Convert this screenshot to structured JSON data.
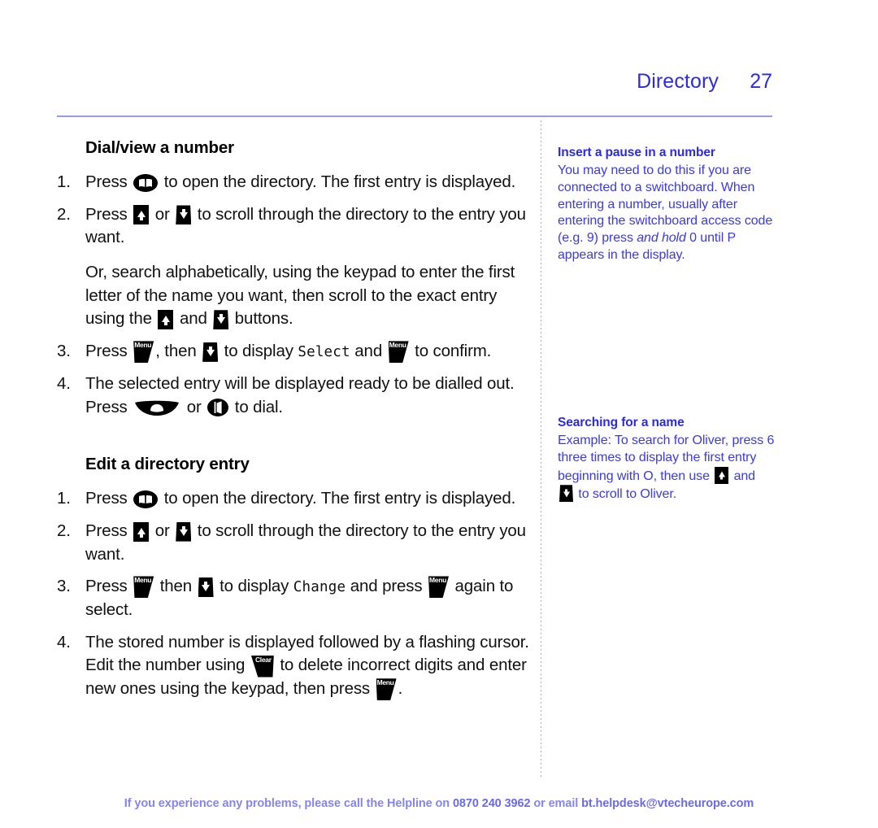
{
  "header": {
    "title": "Directory",
    "page_number": "27"
  },
  "main": {
    "sections": [
      {
        "heading": "Dial/view a number",
        "steps": [
          {
            "number": "1.",
            "parts": [
              {
                "t": "text",
                "v": "Press "
              },
              {
                "t": "icon",
                "v": "directory-book-key"
              },
              {
                "t": "text",
                "v": " to open the directory. The first entry is displayed."
              }
            ]
          },
          {
            "number": "2.",
            "parts": [
              {
                "t": "text",
                "v": "Press "
              },
              {
                "t": "icon",
                "v": "scroll-up-key"
              },
              {
                "t": "text",
                "v": " or "
              },
              {
                "t": "icon",
                "v": "scroll-down-key"
              },
              {
                "t": "text",
                "v": " to scroll through the directory to the entry you want."
              }
            ]
          },
          {
            "number": "",
            "substep": true,
            "parts": [
              {
                "t": "text",
                "v": "Or, search alphabetically, using the keypad to enter the first letter of the name you want, then scroll to the exact entry using the "
              },
              {
                "t": "icon",
                "v": "scroll-up-key"
              },
              {
                "t": "text",
                "v": " and "
              },
              {
                "t": "icon",
                "v": "scroll-down-key"
              },
              {
                "t": "text",
                "v": " buttons."
              }
            ]
          },
          {
            "number": "3.",
            "parts": [
              {
                "t": "text",
                "v": "Press "
              },
              {
                "t": "icon",
                "v": "menu-key"
              },
              {
                "t": "text",
                "v": ", then "
              },
              {
                "t": "icon",
                "v": "scroll-down-key"
              },
              {
                "t": "text",
                "v": " to display "
              },
              {
                "t": "lcd",
                "v": "Select"
              },
              {
                "t": "text",
                "v": " and "
              },
              {
                "t": "icon",
                "v": "menu-key"
              },
              {
                "t": "text",
                "v": " to confirm."
              }
            ]
          },
          {
            "number": "4.",
            "parts": [
              {
                "t": "text",
                "v": "The selected entry will be displayed ready to be dialled out. Press "
              },
              {
                "t": "icon",
                "v": "talk-handset-key"
              },
              {
                "t": "text",
                "v": " or "
              },
              {
                "t": "icon",
                "v": "speakerphone-key"
              },
              {
                "t": "text",
                "v": " to dial."
              }
            ]
          }
        ]
      },
      {
        "heading": "Edit a directory entry",
        "steps": [
          {
            "number": "1.",
            "parts": [
              {
                "t": "text",
                "v": "Press "
              },
              {
                "t": "icon",
                "v": "directory-book-key"
              },
              {
                "t": "text",
                "v": " to open the directory. The first entry is displayed."
              }
            ]
          },
          {
            "number": "2.",
            "parts": [
              {
                "t": "text",
                "v": "Press "
              },
              {
                "t": "icon",
                "v": "scroll-up-key"
              },
              {
                "t": "text",
                "v": " or "
              },
              {
                "t": "icon",
                "v": "scroll-down-key"
              },
              {
                "t": "text",
                "v": " to scroll through the directory to the entry you want."
              }
            ]
          },
          {
            "number": "3.",
            "parts": [
              {
                "t": "text",
                "v": "Press "
              },
              {
                "t": "icon",
                "v": "menu-key"
              },
              {
                "t": "text",
                "v": " then "
              },
              {
                "t": "icon",
                "v": "scroll-down-key"
              },
              {
                "t": "text",
                "v": " to display "
              },
              {
                "t": "lcd",
                "v": "Change"
              },
              {
                "t": "text",
                "v": " and press "
              },
              {
                "t": "icon",
                "v": "menu-key"
              },
              {
                "t": "text",
                "v": " again to select."
              }
            ]
          },
          {
            "number": "4.",
            "parts": [
              {
                "t": "text",
                "v": "The stored number is displayed followed by a flashing cursor. Edit the number using "
              },
              {
                "t": "icon",
                "v": "clear-key"
              },
              {
                "t": "text",
                "v": " to delete incorrect digits and enter new ones using the keypad, then press "
              },
              {
                "t": "icon",
                "v": "menu-key"
              },
              {
                "t": "text",
                "v": "."
              }
            ]
          }
        ]
      }
    ]
  },
  "sidebar": {
    "blocks": [
      {
        "heading": "Insert a pause in a number",
        "parts": [
          {
            "t": "text",
            "v": "You may need to do this if you are connected to a switchboard. When entering a number, usually after entering the switchboard access code (e.g. 9) press "
          },
          {
            "t": "italic",
            "v": "and hold"
          },
          {
            "t": "text",
            "v": " 0 until P appears in the display."
          }
        ]
      },
      {
        "heading": "Searching for a name",
        "parts": [
          {
            "t": "text",
            "v": "Example: To search for Oliver, press 6 three times to display the first entry beginning with O, then use "
          },
          {
            "t": "icon",
            "v": "scroll-up-key"
          },
          {
            "t": "text",
            "v": " and "
          },
          {
            "t": "icon",
            "v": "scroll-down-key"
          },
          {
            "t": "text",
            "v": " to scroll to Oliver."
          }
        ]
      }
    ]
  },
  "footer": {
    "text_before": "If you experience any problems, please call the Helpline on ",
    "phone": "0870 240 3962",
    "text_middle": " or email ",
    "email": "bt.helpdesk@vtecheurope.com"
  },
  "colors": {
    "accent_blue": "#2B2BE6",
    "sidebar_blue": "#3A3AE8",
    "footer_blue": "#8585EE",
    "rule": "#9B9BEE",
    "key_black": "#000000"
  }
}
